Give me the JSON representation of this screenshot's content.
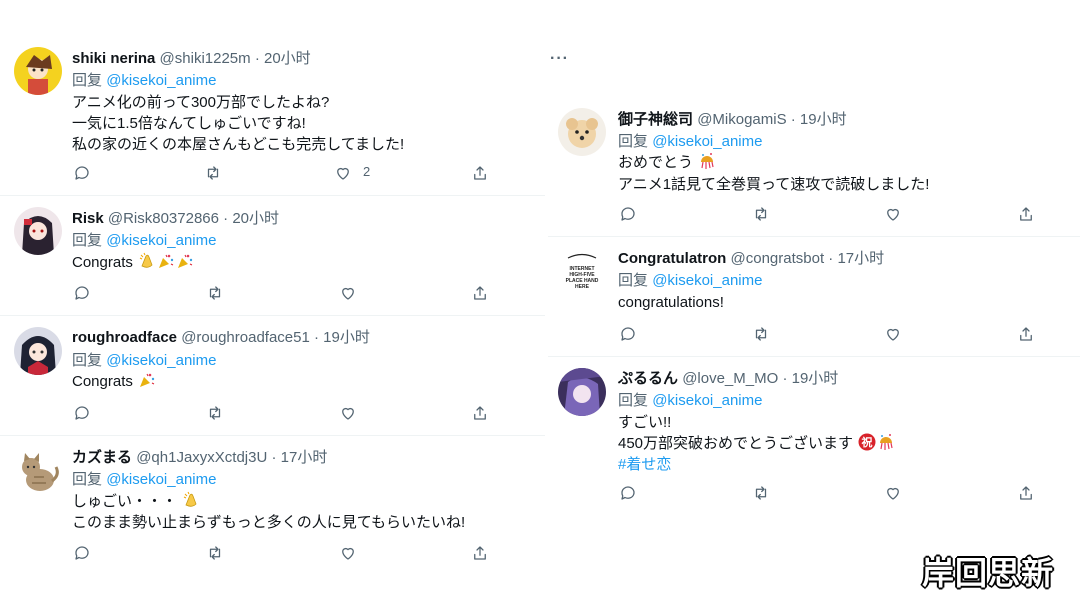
{
  "reply_prefix": "回复",
  "more_menu": "···",
  "watermark": "岸回思新",
  "left_tweets": [
    {
      "display_name": "shiki nerina",
      "meta": "@shiki1225m · 20小时",
      "mention": "@kisekoi_anime",
      "lines": [
        "アニメ化の前って300万部でしたよね?",
        "一気に1.5倍なんてしゅごいですね!",
        "私の家の近くの本屋さんもどこも完売してました!"
      ],
      "like_count": "2"
    },
    {
      "display_name": "Risk",
      "meta": "@Risk80372866 · 20小时",
      "mention": "@kisekoi_anime",
      "lines": [
        "Congrats"
      ],
      "emojis": [
        "clapping-hands",
        "party-popper",
        "party-popper"
      ]
    },
    {
      "display_name": "roughroadface",
      "meta": "@roughroadface51 · 19小时",
      "mention": "@kisekoi_anime",
      "lines": [
        "Congrats"
      ],
      "emojis": [
        "party-popper"
      ]
    },
    {
      "display_name": "カズまる",
      "meta": "@qh1JaxyxXctdj3U · 17小时",
      "mention": "@kisekoi_anime",
      "lines": [
        "しゅごい・・・",
        "このまま勢い止まらずもっと多くの人に見てもらいたいね!"
      ],
      "emojis": [
        "clapping-hands"
      ]
    }
  ],
  "right_tweets": [
    {
      "display_name": "御子神総司",
      "meta": "@MikogamiS · 19小时",
      "mention": "@kisekoi_anime",
      "lines": [
        "おめでとう",
        "アニメ1話見て全巻買って速攻で読破しました!"
      ],
      "emojis": [
        "confetti-ball"
      ]
    },
    {
      "display_name": "Congratulatron",
      "meta": "@congratsbot · 17小时",
      "mention": "@kisekoi_anime",
      "lines": [
        "congratulations!"
      ],
      "avatar_text": [
        "INTERNET",
        "HIGH-FIVE",
        "PLACE HAND",
        "HERE"
      ]
    },
    {
      "display_name": "ぷるるん",
      "meta": "@love_M_MO · 19小时",
      "mention": "@kisekoi_anime",
      "lines": [
        "すごい!!",
        "450万部突破おめでとうございます"
      ],
      "hashtag": "#着せ恋",
      "emojis": [
        "congratulations-kanji",
        "confetti-ball"
      ],
      "emoji_kanji": "祝"
    }
  ],
  "icons": [
    "reply-icon",
    "retweet-icon",
    "like-icon",
    "share-icon"
  ],
  "colors": {
    "link": "#1d9bf0",
    "secondary": "#536471",
    "text": "#0f1419",
    "divider": "#eff3f4"
  }
}
